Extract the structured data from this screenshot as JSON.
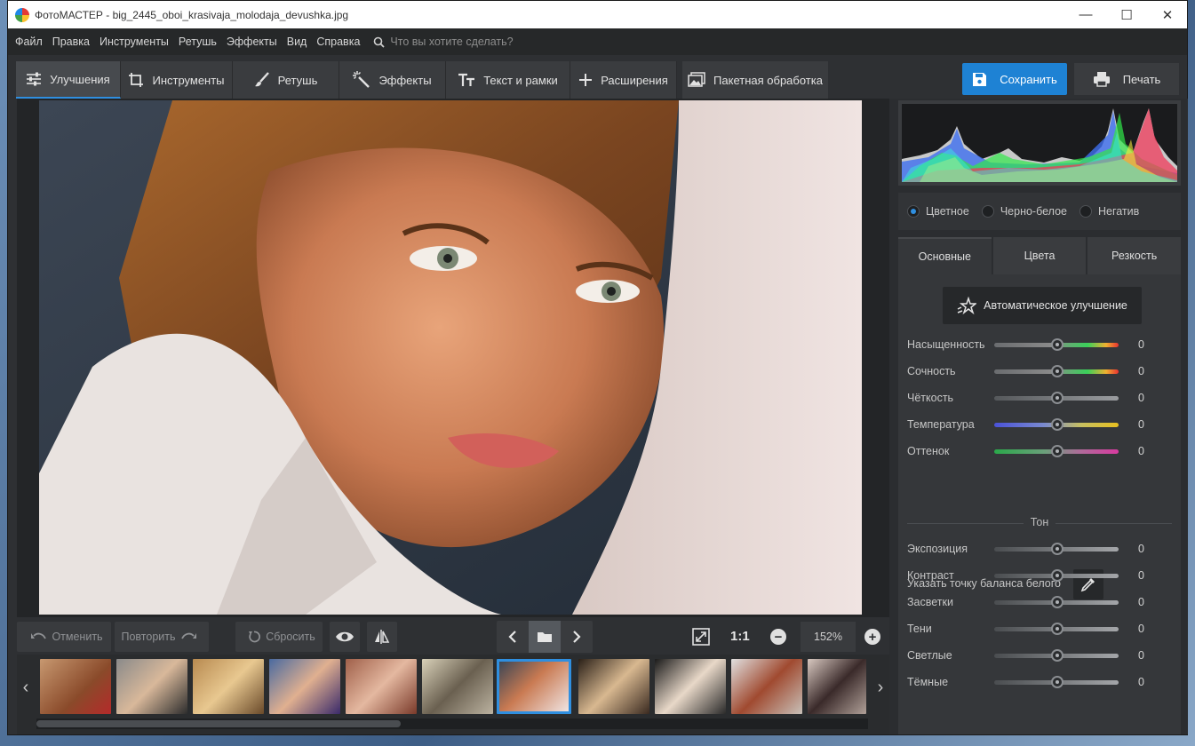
{
  "window": {
    "title": "ФотоМАСТЕР - big_2445_oboi_krasivaja_molodaja_devushka.jpg",
    "controls": [
      "—",
      "☐",
      "✕"
    ]
  },
  "menu": {
    "items": [
      "Файл",
      "Правка",
      "Инструменты",
      "Ретушь",
      "Эффекты",
      "Вид",
      "Справка"
    ],
    "search_placeholder": "Что вы хотите сделать?"
  },
  "toolbar": {
    "tabs": [
      "Улучшения",
      "Инструменты",
      "Ретушь",
      "Эффекты",
      "Текст и рамки",
      "Расширения"
    ],
    "batch": "Пакетная обработка",
    "save": "Сохранить",
    "print": "Печать"
  },
  "bottom": {
    "undo": "Отменить",
    "redo": "Повторить",
    "reset": "Сбросить",
    "one_to_one": "1:1",
    "zoom": "152%"
  },
  "color_modes": {
    "items": [
      "Цветное",
      "Черно-белое",
      "Негатив"
    ],
    "selected": 0
  },
  "panel_tabs": [
    "Основные",
    "Цвета",
    "Резкость"
  ],
  "auto_enhance": "Автоматическое улучшение",
  "sliders": [
    {
      "label": "Насыщенность",
      "value": "0"
    },
    {
      "label": "Сочность",
      "value": "0"
    },
    {
      "label": "Чёткость",
      "value": "0"
    },
    {
      "label": "Температура",
      "value": "0"
    },
    {
      "label": "Оттенок",
      "value": "0"
    }
  ],
  "white_balance": "Указать точку баланса белого",
  "tone_title": "Тон",
  "tone_sliders": [
    {
      "label": "Экспозиция",
      "value": "0"
    },
    {
      "label": "Контраст",
      "value": "0"
    },
    {
      "label": "Засветки",
      "value": "0"
    },
    {
      "label": "Тени",
      "value": "0"
    },
    {
      "label": "Светлые",
      "value": "0"
    },
    {
      "label": "Тёмные",
      "value": "0"
    }
  ],
  "colors": {
    "accent": "#1e82d4",
    "selection": "#2f8fe0"
  }
}
